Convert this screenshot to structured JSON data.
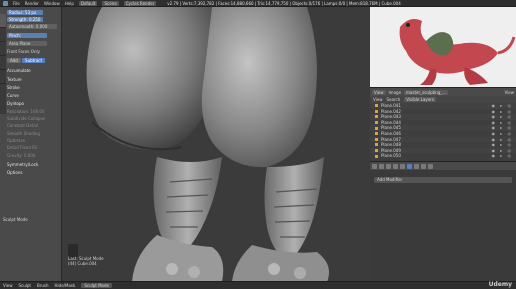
{
  "topbar": {
    "menus": [
      "File",
      "Render",
      "Window",
      "Help"
    ],
    "layout": "Default",
    "scene": "Scene",
    "engine": "Cycles Render",
    "stats": "v2.79 | Verts:7,392,782 | Faces:14,880,660 | Tris:14,779,750 | Objects:0/176 | Lamps:0/0 | Mem:818.76M | Cube.004"
  },
  "tools": {
    "sections": {
      "brush_radius_label": "Radius:",
      "brush_radius_value": "53 px",
      "strength_label": "Strength:",
      "strength_value": "0.250",
      "autosmooth_label": "Autosmooth:",
      "autosmooth_value": "0.000",
      "plane": "Area Plane",
      "front_faces": "Front Faces Only",
      "add": "Add",
      "subtract": "Subtract",
      "accumulate": "Accumulate",
      "texture": "Texture",
      "stroke": "Stroke",
      "curve": "Curve",
      "dyntopo": "Dyntopo",
      "detail_size": "Resolution: 160.00",
      "sub_collapse": "Subdivide Collapse",
      "constant": "Constant Detail",
      "smooth_shading": "Smooth Shading",
      "optimize": "Optimize",
      "detail_flood": "Detail Flood Fill",
      "gravity": "Gravity: 0.000",
      "symmetry": "Symmetry/Lock",
      "options": "Options"
    },
    "status": "Sculpt Mode",
    "pinch": "Pinch:"
  },
  "viewport": {
    "hint": "(44) Cube.004",
    "hint_prefix": "Last: Sculpt Mode"
  },
  "outliner": {
    "view": "View",
    "search": "Search",
    "filter": "Visible Layers",
    "header_view": "View",
    "header_image": "Image",
    "header_file": "master_sculpting_...",
    "header_view2": "View",
    "items": [
      "Plane.041",
      "Plane.042",
      "Plane.043",
      "Plane.044",
      "Plane.045",
      "Plane.046",
      "Plane.047",
      "Plane.048",
      "Plane.049",
      "Plane.050"
    ]
  },
  "properties": {
    "add_modifier": "Add Modifier"
  },
  "bottombar": {
    "items": [
      "View",
      "Sculpt",
      "Brush",
      "Hide/Mask"
    ],
    "mode": "Sculpt Mode"
  },
  "watermark": "Udemy"
}
